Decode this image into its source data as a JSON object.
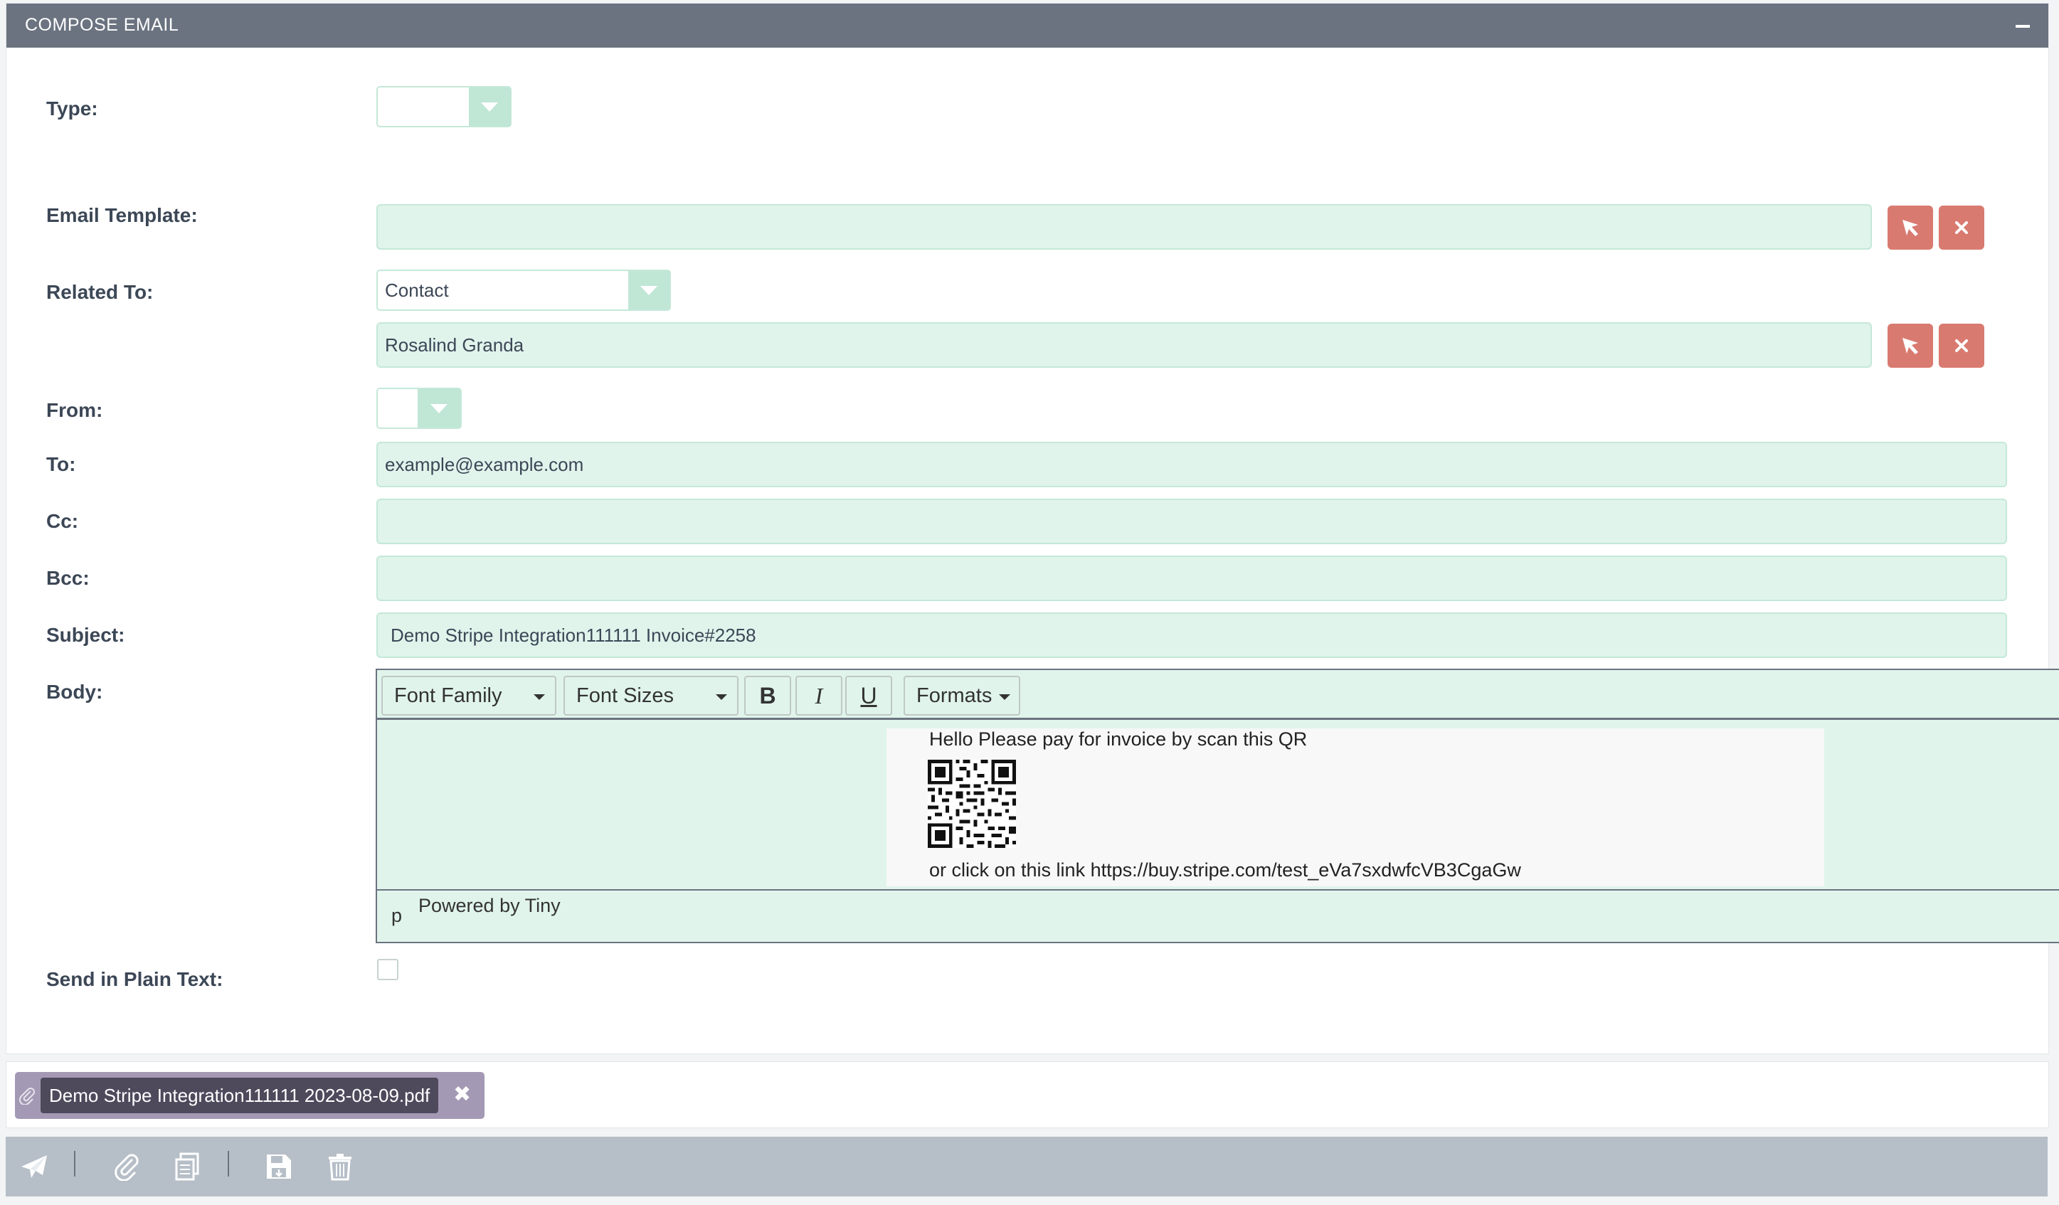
{
  "header": {
    "title": "COMPOSE EMAIL",
    "collapse_icon": "minus-icon"
  },
  "form": {
    "type_label": "Type:",
    "type_value": "",
    "email_template_label": "Email Template:",
    "email_template_value": "",
    "related_to_label": "Related To:",
    "related_to_type": "Contact",
    "related_to_record": "Rosalind Granda",
    "from_label": "From:",
    "from_value": "",
    "to_label": "To:",
    "to_value": "example@example.com",
    "cc_label": "Cc:",
    "cc_value": "",
    "bcc_label": "Bcc:",
    "bcc_value": "",
    "subject_label": "Subject:",
    "subject_value": "Demo Stripe Integration111111 Invoice#2258",
    "body_label": "Body:",
    "plain_text_label": "Send in Plain Text:",
    "plain_text_checked": false
  },
  "editor": {
    "font_family": "Font Family",
    "font_sizes": "Font Sizes",
    "bold": "B",
    "italic": "I",
    "underline": "U",
    "formats": "Formats",
    "line1": "Hello Please pay for invoice by scan this QR",
    "line2": "or click on this link https://buy.stripe.com/test_eVa7sxdwfcVB3CgaGw",
    "path": "p",
    "powered_by": "Powered by Tiny"
  },
  "attachment": {
    "filename": "Demo Stripe Integration111111 2023-08-09.pdf",
    "remove": "✖"
  },
  "icons": {
    "select": "cursor-arrow-icon",
    "clear": "close-icon",
    "send": "send-icon",
    "attach": "paperclip-icon",
    "template": "document-icon",
    "save": "save-draft-icon",
    "delete": "trash-icon"
  },
  "colors": {
    "header": "#6b7380",
    "field_bg": "#e0f4ec",
    "action_button": "#d97a70",
    "attachment_chip": "#a499b4",
    "bottom_bar": "#b6bec7"
  }
}
